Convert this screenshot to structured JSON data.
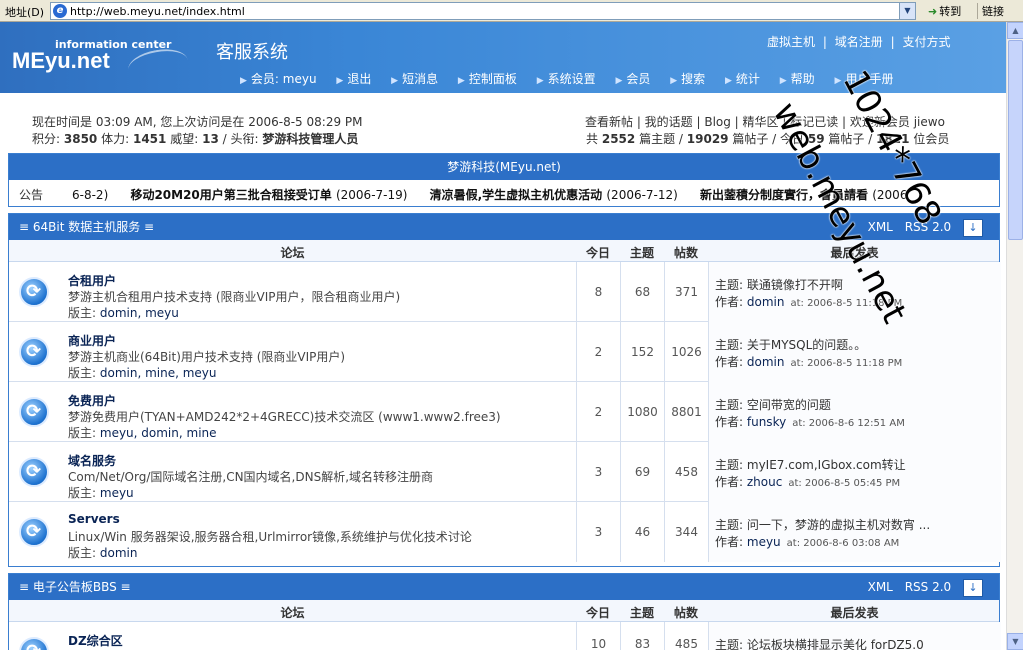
{
  "browser": {
    "address_label": "地址(D)",
    "url": "http://web.meyu.net/index.html",
    "go_label": "转到",
    "links_label": "链接"
  },
  "header": {
    "logo_sub": "information center",
    "logo_main": "MEyu.net",
    "site_title": "客服系统",
    "top_links": [
      "虚拟主机",
      "|",
      "域名注册",
      "|",
      "支付方式"
    ],
    "nav": [
      "会员: meyu",
      "退出",
      "短消息",
      "控制面板",
      "系统设置",
      "会员",
      "搜索",
      "统计",
      "帮助",
      "用户手册"
    ]
  },
  "info": {
    "line1": "现在时间是 03:09 AM, 您上次访问是在 2006-8-5 08:29 PM",
    "points_label": "积分:",
    "points": "3850",
    "stamina_label": "体力:",
    "stamina": "1451",
    "prestige_label": "威望:",
    "prestige": "13",
    "title_label": "/ 头衔:",
    "title": "梦游科技管理人员",
    "right_links": "查看新帖 | 我的话题 | Blog | 精华区 | 标记已读 | 欢迎新会员 jiewo",
    "stats_prefix": "共",
    "topics": "2552",
    "topics_label": "篇主题 /",
    "posts": "19029",
    "posts_label": "篇帖子 / 今日",
    "today": "59",
    "today_label": "篇帖子 /",
    "members": "1821",
    "members_label": "位会员"
  },
  "announce": {
    "head": "梦游科技(MEyu.net)",
    "label": "公告",
    "items": [
      {
        "title": "",
        "date": "6-8-2)"
      },
      {
        "title": "移动20M20用户第三批合租接受订单",
        "date": "(2006-7-19)"
      },
      {
        "title": "清凉暑假,学生虚拟主机优惠活动",
        "date": "(2006-7-12)"
      },
      {
        "title": "新出蓥積分制度實行，會員請看",
        "date": "(2006"
      }
    ]
  },
  "sections": [
    {
      "title": "≡ 64Bit 数据主机服务 ≡",
      "xml": "XML",
      "rss": "RSS 2.0",
      "cols": {
        "forum": "论坛",
        "today": "今日",
        "topics": "主题",
        "posts": "帖数",
        "last": "最后发表"
      },
      "rows": [
        {
          "name": "合租用户",
          "desc": "梦游主机合租用户技术支持 (限商业VIP用户，限合租商业用户)",
          "mods_label": "版主:",
          "mods": "domin, meyu",
          "today": "8",
          "topics": "68",
          "posts": "371",
          "lp_label": "主题:",
          "lp_title": "联通镜像打不开啊",
          "by_label": "作者:",
          "author": "domin",
          "at": "at: 2006-8-5 11:18 PM"
        },
        {
          "name": "商业用户",
          "desc": "梦游主机商业(64Bit)用户技术支持 (限商业VIP用户)",
          "mods_label": "版主:",
          "mods": "domin, mine, meyu",
          "today": "2",
          "topics": "152",
          "posts": "1026",
          "lp_label": "主题:",
          "lp_title": "关于MYSQL的问题。。",
          "by_label": "作者:",
          "author": "domin",
          "at": "at: 2006-8-5 11:18 PM"
        },
        {
          "name": "免费用户",
          "desc": "梦游免费用户(TYAN+AMD242*2+4GRECC)技术交流区 (www1.www2.free3)",
          "mods_label": "版主:",
          "mods": "meyu, domin, mine",
          "today": "2",
          "topics": "1080",
          "posts": "8801",
          "lp_label": "主题:",
          "lp_title": "空间带宽的问题",
          "by_label": "作者:",
          "author": "funsky",
          "at": "at: 2006-8-6 12:51 AM"
        },
        {
          "name": "域名服务",
          "desc": "Com/Net/Org/国际域名注册,CN国内域名,DNS解析,域名转移注册商",
          "mods_label": "版主:",
          "mods": "meyu",
          "today": "3",
          "topics": "69",
          "posts": "458",
          "lp_label": "主题:",
          "lp_title": "myIE7.com,IGbox.com转让",
          "by_label": "作者:",
          "author": "zhouc",
          "at": "at: 2006-8-5 05:45 PM"
        },
        {
          "name": "Servers",
          "desc": "Linux/Win 服务器架设,服务器合租,Urlmirror镜像,系统维护与优化技术讨论",
          "mods_label": "版主:",
          "mods": "domin",
          "today": "3",
          "topics": "46",
          "posts": "344",
          "lp_label": "主题:",
          "lp_title": "问一下，梦游的虚拟主机对数宵 ...",
          "by_label": "作者:",
          "author": "meyu",
          "at": "at: 2006-8-6 03:08 AM"
        }
      ]
    },
    {
      "title": "≡ 电子公告板BBS ≡",
      "xml": "XML",
      "rss": "RSS 2.0",
      "cols": {
        "forum": "论坛",
        "today": "今日",
        "topics": "主题",
        "posts": "帖数",
        "last": "最后发表"
      },
      "rows": [
        {
          "name": "DZ综合区",
          "desc": "",
          "mods_label": "",
          "mods": "",
          "today": "10",
          "topics": "83",
          "posts": "485",
          "lp_label": "主题:",
          "lp_title": "论坛板块横排显示美化 forDZ5.0",
          "by_label": "",
          "author": "",
          "at": ""
        }
      ]
    }
  ],
  "watermark": {
    "line1": "1024*768",
    "line2": "web.meyu.net"
  }
}
